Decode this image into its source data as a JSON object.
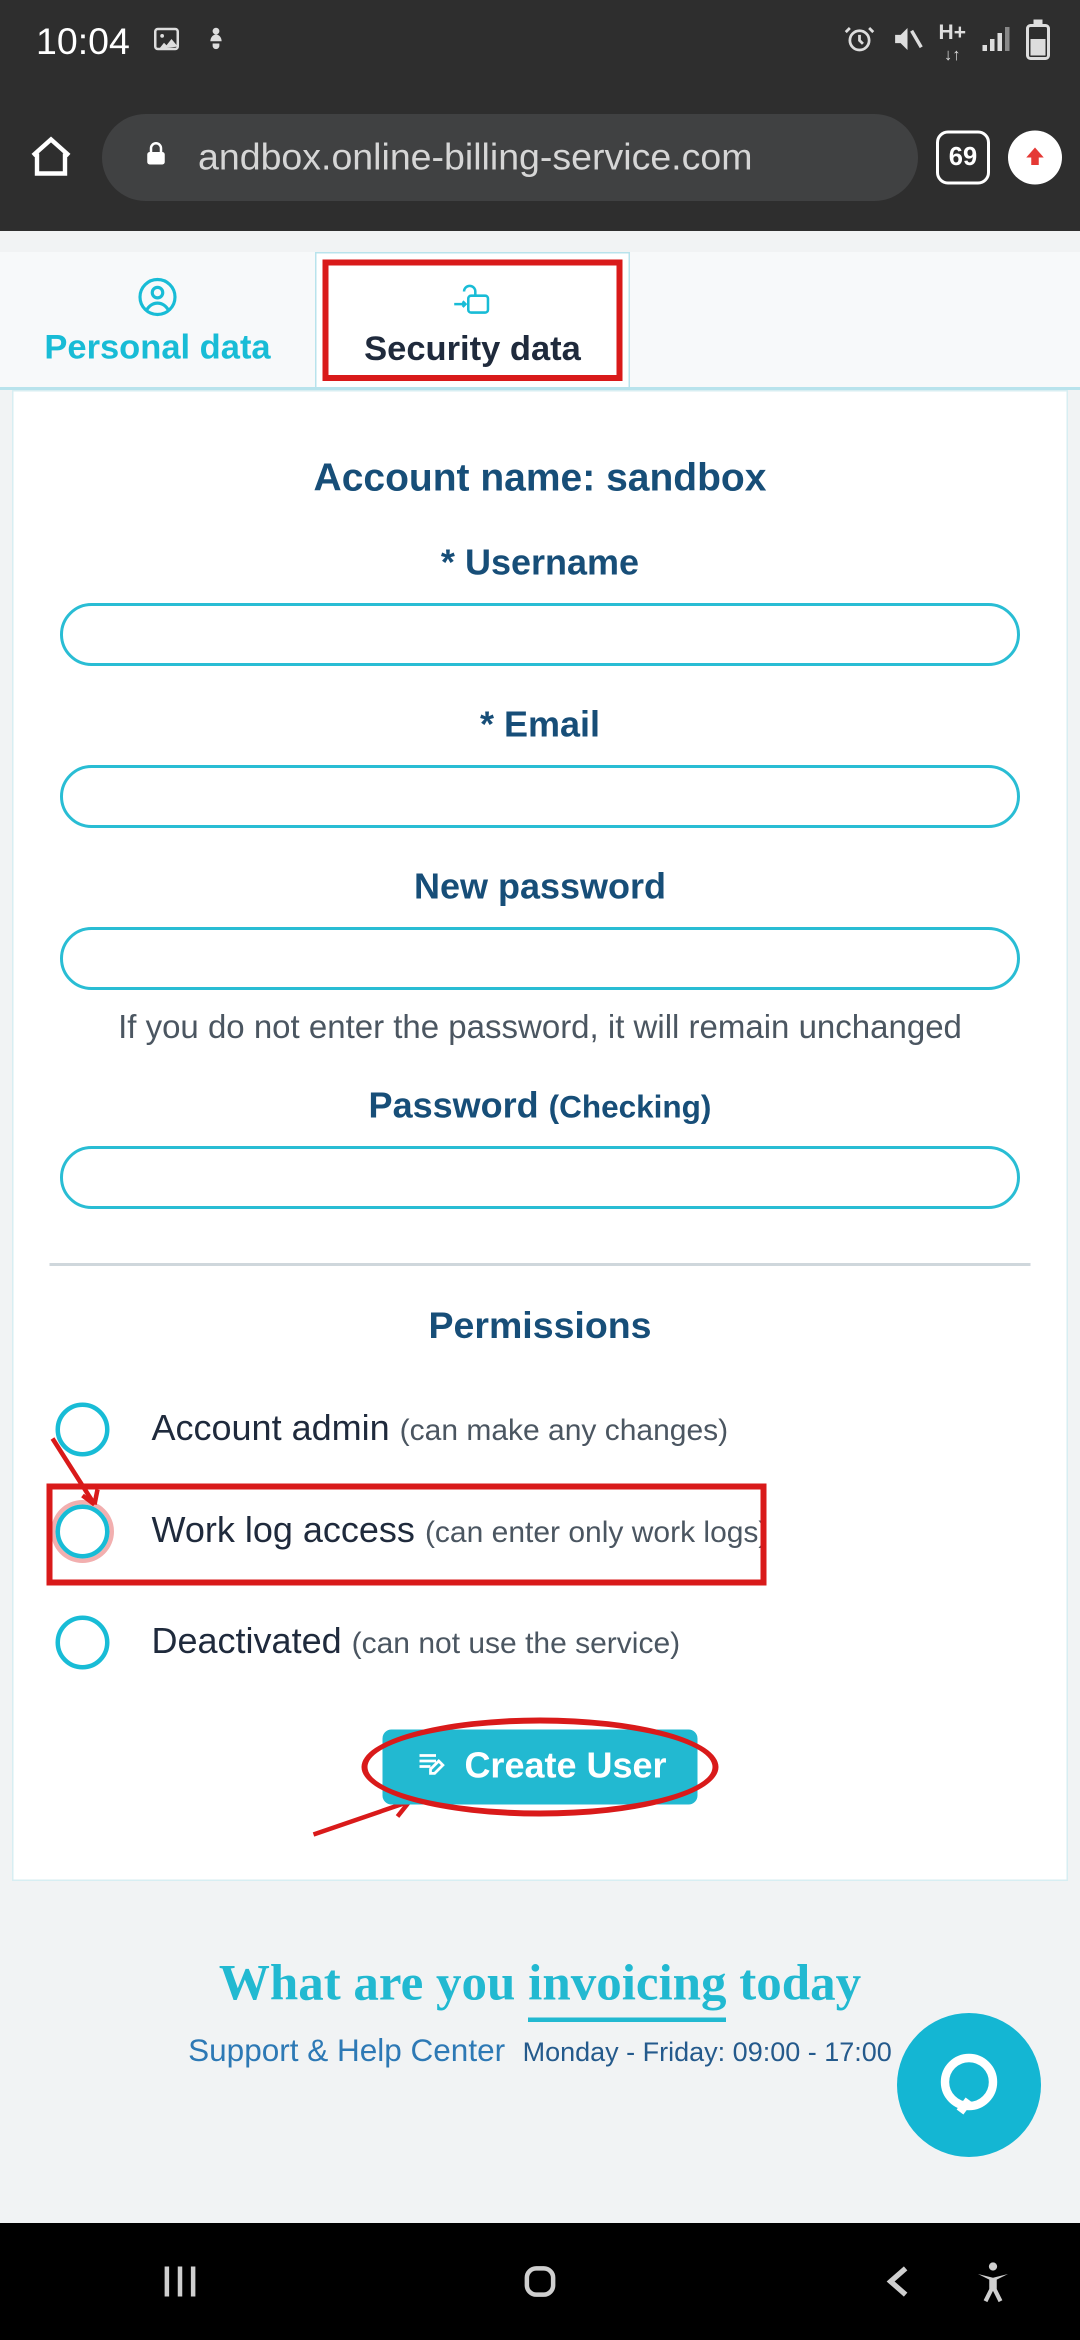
{
  "status": {
    "time": "10:04",
    "network_label": "H+"
  },
  "browser": {
    "url_display": "andbox.online-billing-service.com",
    "tab_count": "69"
  },
  "tabs": {
    "personal": {
      "label": "Personal data"
    },
    "security": {
      "label": "Security data"
    }
  },
  "form": {
    "account_line_prefix": "Account name: ",
    "account_name": "sandbox",
    "username_label": "Username",
    "email_label": "Email",
    "new_password_label": "New password",
    "password_hint": "If you do not enter the password, it will remain unchanged",
    "password_check_label": "Password",
    "password_check_paren": "(Checking)"
  },
  "permissions": {
    "header": "Permissions",
    "options": [
      {
        "label": "Account admin",
        "note": "(can make any changes)"
      },
      {
        "label": "Work log access",
        "note": "(can enter only work logs)"
      },
      {
        "label": "Deactivated",
        "note": "(can not use the service)"
      }
    ]
  },
  "create_button": "Create User",
  "footer": {
    "line1_a": "What are you ",
    "line1_b": "invoicing",
    "line1_c": " today",
    "support_label": "Support & Help Center",
    "hours": "Monday - Friday: 09:00 - 17:00"
  }
}
